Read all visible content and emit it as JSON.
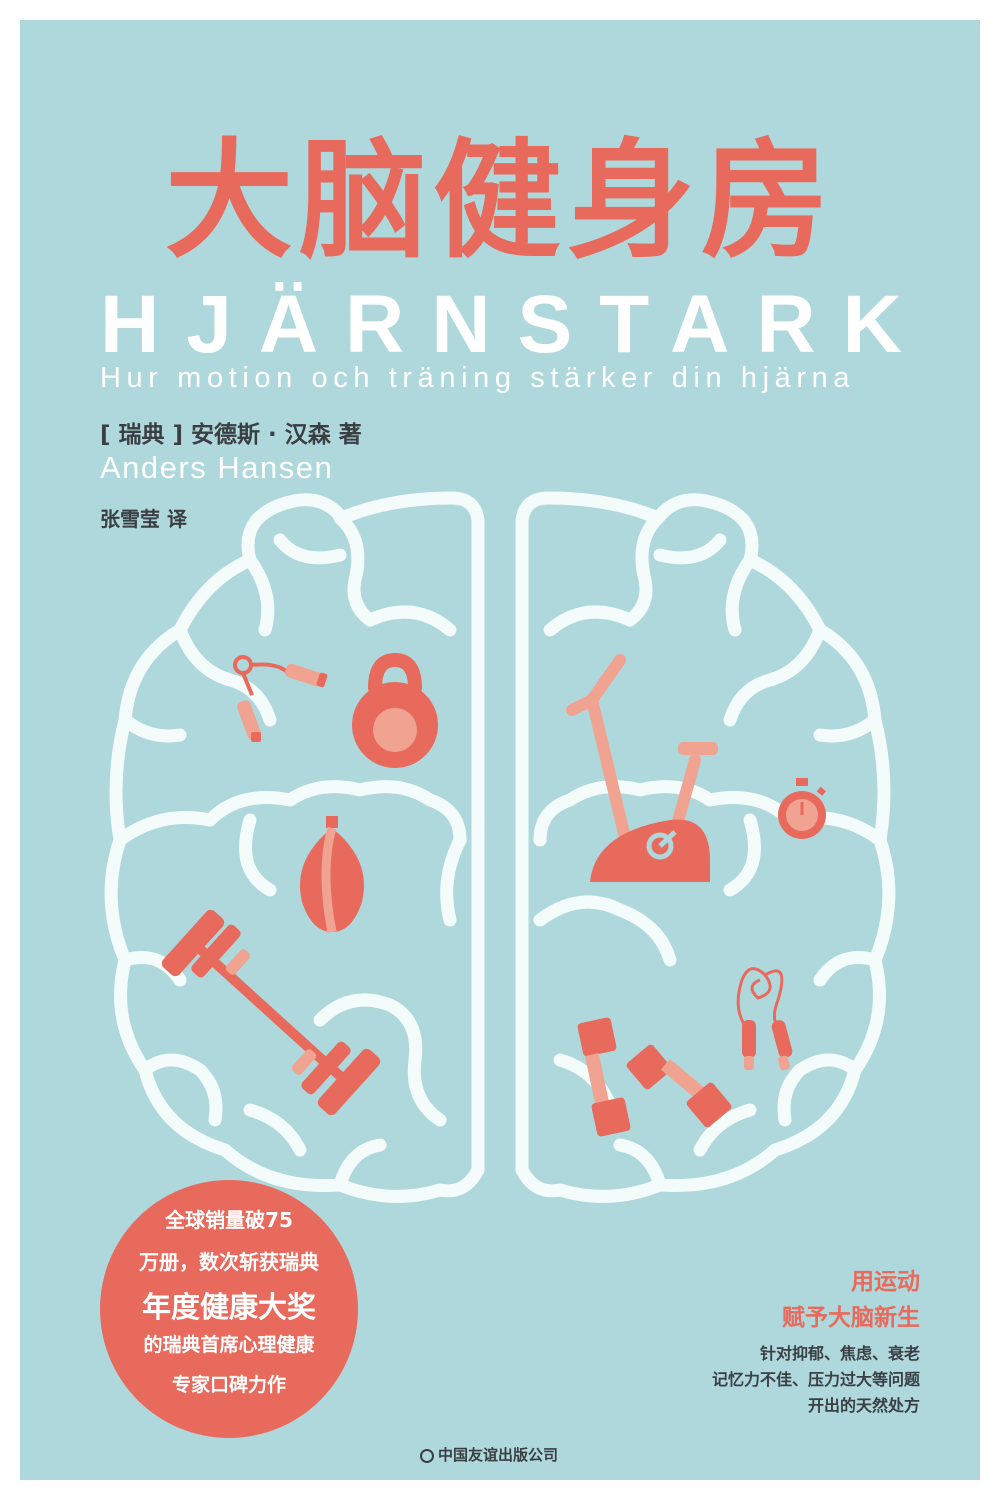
{
  "cover": {
    "title_cn": "大脑健身房",
    "title_sv": "HJÄRNSTARK",
    "subtitle_sv": "Hur motion och träning stärker din hjärna",
    "author_cn": "[ 瑞典 ] 安德斯 · 汉森   著",
    "author_en": "Anders Hansen",
    "translator": "张雪莹   译",
    "badge": [
      "全球销量破75",
      "万册，数次斩获瑞典",
      "年度健康大奖",
      "的瑞典首席心理健康",
      "专家口碑力作"
    ],
    "slogan": [
      "用运动",
      "赋予大脑新生"
    ],
    "description": [
      "针对抑郁、焦虑、衰老",
      "记忆力不佳、压力过大等问题",
      "开出的天然处方"
    ],
    "publisher": "中国友谊出版公司"
  },
  "icons": {
    "left": [
      "hand-gripper-icon",
      "kettlebell-icon",
      "speed-bag-icon",
      "barbell-icon"
    ],
    "right": [
      "exercise-bike-icon",
      "stopwatch-icon",
      "jump-rope-icon",
      "dumbbells-icon"
    ]
  },
  "colors": {
    "background": "#afd8dc",
    "accent": "#e86a5c",
    "accent_light": "#f0a391",
    "outline": "#f4fbfb",
    "text_dark": "#3a3f44"
  }
}
